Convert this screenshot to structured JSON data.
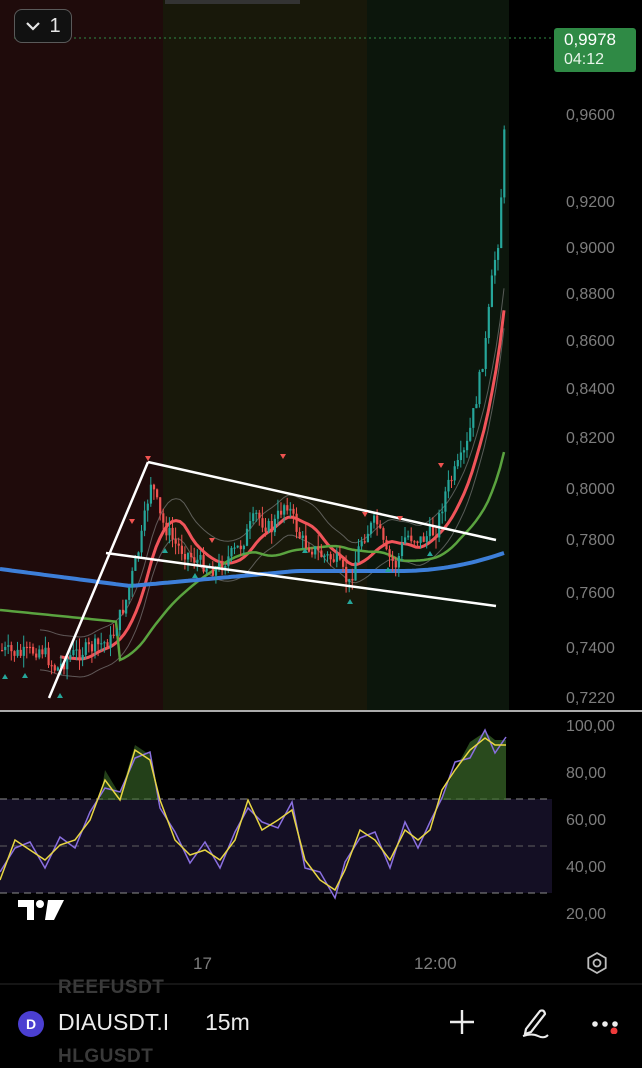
{
  "toolbar": {
    "layers_count": "1"
  },
  "price_badge": {
    "price": "0,9978",
    "countdown": "04:12",
    "color": "#2f8a45"
  },
  "price_axis": [
    "0,9600",
    "0,9200",
    "0,9000",
    "0,8800",
    "0,8600",
    "0,8400",
    "0,8200",
    "0,8000",
    "0,7800",
    "0,7600",
    "0,7400",
    "0,7220"
  ],
  "rsi_axis": [
    "100,00",
    "80,00",
    "60,00",
    "40,00",
    "20,00"
  ],
  "time_axis": [
    "17",
    "12:00"
  ],
  "ghost_symbols": [
    "REEFUSDT",
    "HLGUSDT"
  ],
  "bottom_bar": {
    "symbol": "DIAUSDT.P",
    "symbol_short": "DIAUSDT.I",
    "interval": "15m",
    "symbol_icon_letter": "D"
  },
  "colors": {
    "up": "#26a69a",
    "down": "#ef5350",
    "ema_red": "#f0545a",
    "ema_blue": "#3d7fd9",
    "ema_green": "#5aa33f",
    "rsi": "#8a6fe0",
    "rsi_ma": "#e9d743",
    "zone_red": "#1f0b0b",
    "zone_yellow": "#18180a",
    "zone_green": "#0c160c"
  }
}
